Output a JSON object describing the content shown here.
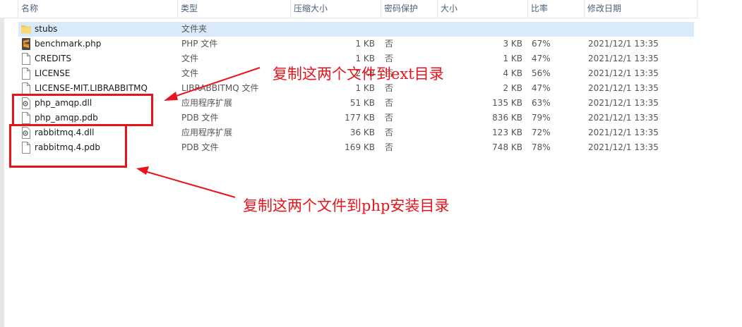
{
  "columns": {
    "name": "名称",
    "type": "类型",
    "compressed_size": "压缩大小",
    "password": "密码保护",
    "size": "大小",
    "ratio": "比率",
    "modified": "修改日期"
  },
  "files": [
    {
      "name": "stubs",
      "type": "文件夹",
      "csize": "",
      "prot": "",
      "size": "",
      "ratio": "",
      "date": "",
      "icon": "folder-icon"
    },
    {
      "name": "benchmark.php",
      "type": "PHP 文件",
      "csize": "1 KB",
      "prot": "否",
      "size": "3 KB",
      "ratio": "67%",
      "date": "2021/12/1 13:35",
      "icon": "sublime-file-icon"
    },
    {
      "name": "CREDITS",
      "type": "文件",
      "csize": "1 KB",
      "prot": "否",
      "size": "1 KB",
      "ratio": "47%",
      "date": "2021/12/1 13:35",
      "icon": "file-icon"
    },
    {
      "name": "LICENSE",
      "type": "文件",
      "csize": "2 KB",
      "prot": "否",
      "size": "4 KB",
      "ratio": "56%",
      "date": "2021/12/1 13:35",
      "icon": "file-icon"
    },
    {
      "name": "LICENSE-MIT.LIBRABBITMQ",
      "type": "LIBRABBITMQ 文件",
      "csize": "1 KB",
      "prot": "否",
      "size": "2 KB",
      "ratio": "47%",
      "date": "2021/12/1 13:35",
      "icon": "file-icon"
    },
    {
      "name": "php_amqp.dll",
      "type": "应用程序扩展",
      "csize": "51 KB",
      "prot": "否",
      "size": "135 KB",
      "ratio": "63%",
      "date": "2021/12/1 13:35",
      "icon": "dll-file-icon"
    },
    {
      "name": "php_amqp.pdb",
      "type": "PDB 文件",
      "csize": "177 KB",
      "prot": "否",
      "size": "836 KB",
      "ratio": "79%",
      "date": "2021/12/1 13:35",
      "icon": "file-icon"
    },
    {
      "name": "rabbitmq.4.dll",
      "type": "应用程序扩展",
      "csize": "36 KB",
      "prot": "否",
      "size": "123 KB",
      "ratio": "72%",
      "date": "2021/12/1 13:35",
      "icon": "dll-file-icon"
    },
    {
      "name": "rabbitmq.4.pdb",
      "type": "PDB 文件",
      "csize": "169 KB",
      "prot": "否",
      "size": "748 KB",
      "ratio": "78%",
      "date": "2021/12/1 13:35",
      "icon": "file-icon"
    }
  ],
  "annotations": {
    "ext_text": "复制这两个文件到ext目录",
    "php_text": "复制这两个文件到php安装目录",
    "color": "#e8131b"
  }
}
